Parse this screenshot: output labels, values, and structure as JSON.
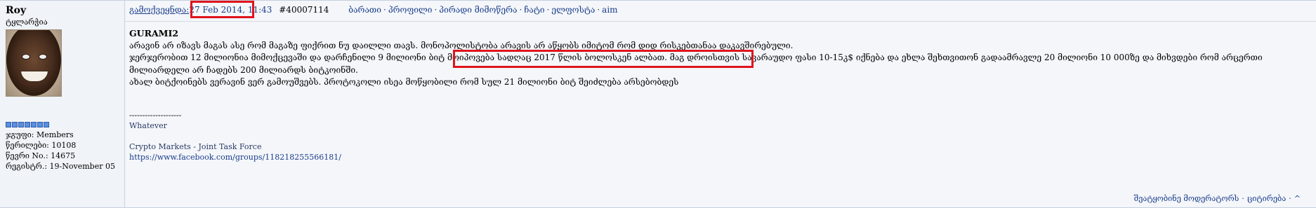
{
  "author": {
    "username": "Roy",
    "title": "ტყლარჭია",
    "group_label": "ჯგუფი:",
    "group_value": "Members",
    "posts_label": "წერილები:",
    "posts_value": "10108",
    "member_no_label": "წევრი No.:",
    "member_no_value": "14675",
    "registered_label": "რეგისტრ.:",
    "registered_value": "19-November 05"
  },
  "header": {
    "posted_label": "გამოქვეყნდა:",
    "date": "27 Feb 2014, 11:43",
    "post_id": "#40007114",
    "links": [
      "ბარათი",
      "პროფილი",
      "პირადი მიმოწერა",
      "ჩატი",
      "ელფოსტა",
      "aim"
    ]
  },
  "post": {
    "title": "GURAMI2",
    "lines": [
      "არავინ არ იზავს მაგას ასე რომ მაგაზე ფიქრით ნუ დაილლი თავს. მონოპოლისტობა არავის არ აწყობს იმიტომ რომ დიდ რისკებთანაა დაკავშირებული.",
      "ჯერჯერობით 12 მილიონია მიმოქცევაში და დარჩენილი 9 მილიონი ბიტ მოიპოვება სადღაც 2017 წლის ბოლოსკენ ალბათ. მაგ დროისთვის სავარაუდო ფასი 10-15კ$ იქნება და ეხლა შეხთვითონ გადაამრავლე 20 მილიონი 10 000ზე და მიხვდები რომ არცერთი",
      "მილიარდელი არ ჩადებს 200 მილიარდს ბიტკოინში.",
      "ახალ ბიტქოინებს ვერავინ ვერ გამოუშვებს. პროტოკოლი ისეა მოწყობილი რომ სულ 21 მილიონი ბიტ შეიძლება არსებობდეს"
    ]
  },
  "signature": {
    "divider": "--------------------",
    "line1": "Whatever",
    "line2": "Crypto Markets - Joint Task Force",
    "url": "https://www.facebook.com/groups/118218255566181/"
  },
  "footer": {
    "report": "შეატყობინე მოდერატორს",
    "quote": "ციტირება",
    "up": "^"
  }
}
